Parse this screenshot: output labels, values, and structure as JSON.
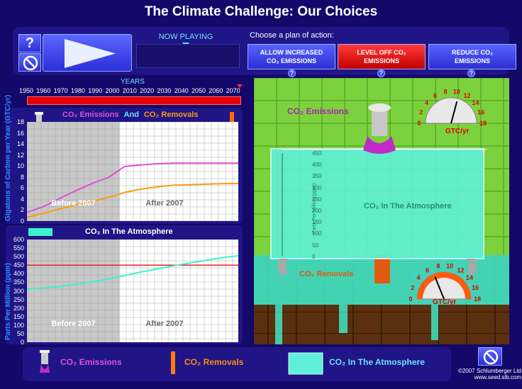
{
  "title": "The Climate Challenge: Our Choices",
  "controls": {
    "help_label": "?",
    "now_playing_label": "NOW PLAYING",
    "now_playing_value": ""
  },
  "plan": {
    "prompt": "Choose a plan of action:",
    "options": [
      {
        "line1": "ALLOW INCREASED",
        "line2": "CO₂ EMISSIONS",
        "selected": false
      },
      {
        "line1": "LEVEL OFF CO₂",
        "line2": "EMISSIONS",
        "selected": true
      },
      {
        "line1": "REDUCE CO₂",
        "line2": "EMISSIONS",
        "selected": false
      }
    ],
    "option_help": "?"
  },
  "timeline": {
    "label": "YEARS",
    "years": [
      "1950",
      "1960",
      "1970",
      "1980",
      "1990",
      "2000",
      "2010",
      "2020",
      "2030",
      "2040",
      "2050",
      "2060",
      "2070"
    ]
  },
  "chart_emissions": {
    "title_part1": "CO₂ Emissions",
    "title_and": "And",
    "title_part2": "CO₂ Removals",
    "ylabel": "Gigatons of Carbon per Year (GTC/yr)",
    "before_label": "Before 2007",
    "after_label": "After 2007",
    "colors": {
      "emissions": "#e050d8",
      "removals": "#ff9a10"
    }
  },
  "chart_atmosphere": {
    "title": "CO₂ In The Atmosphere",
    "ylabel": "Parts Per Million (ppm)",
    "before_label": "Before 2007",
    "after_label": "After 2007",
    "colors": {
      "co2": "#3ff0d0",
      "threshold": "#e82020"
    }
  },
  "chart_data": [
    {
      "type": "line",
      "title": "CO₂ Emissions And CO₂ Removals",
      "xlabel": "",
      "ylabel": "Gigatons of Carbon per Year (GTC/yr)",
      "xlim": [
        1950,
        2080
      ],
      "ylim": [
        0,
        18
      ],
      "yticks": [
        0,
        2,
        4,
        6,
        8,
        10,
        12,
        14,
        16,
        18
      ],
      "divider_x": 2007,
      "series": [
        {
          "name": "CO₂ Emissions",
          "x": [
            1950,
            1960,
            1970,
            1980,
            1990,
            2000,
            2007,
            2010,
            2020,
            2030,
            2040,
            2050,
            2060,
            2070,
            2080
          ],
          "values": [
            1.6,
            2.6,
            4.1,
            5.5,
            6.8,
            7.9,
            9.3,
            9.9,
            10.2,
            10.4,
            10.5,
            10.5,
            10.5,
            10.5,
            10.5
          ]
        },
        {
          "name": "CO₂ Removals",
          "x": [
            1950,
            1960,
            1970,
            1980,
            1990,
            2000,
            2007,
            2010,
            2020,
            2030,
            2040,
            2050,
            2060,
            2070,
            2080
          ],
          "values": [
            0.7,
            1.4,
            2.2,
            2.9,
            3.6,
            4.3,
            4.9,
            5.2,
            5.8,
            6.2,
            6.5,
            6.6,
            6.7,
            6.8,
            6.8
          ]
        }
      ]
    },
    {
      "type": "line",
      "title": "CO₂ In The Atmosphere",
      "xlabel": "",
      "ylabel": "Parts Per Million (ppm)",
      "xlim": [
        1950,
        2080
      ],
      "ylim": [
        0,
        600
      ],
      "yticks": [
        0,
        50,
        100,
        150,
        200,
        250,
        300,
        350,
        400,
        450,
        500,
        550,
        600
      ],
      "divider_x": 2007,
      "threshold": 450,
      "series": [
        {
          "name": "CO₂ In The Atmosphere",
          "x": [
            1950,
            1960,
            1970,
            1980,
            1990,
            2000,
            2007,
            2010,
            2020,
            2030,
            2040,
            2050,
            2060,
            2070,
            2080
          ],
          "values": [
            310,
            317,
            325,
            338,
            353,
            369,
            383,
            390,
            410,
            428,
            446,
            462,
            478,
            494,
            505
          ]
        }
      ]
    }
  ],
  "scene": {
    "emissions_label": "CO₂ Emissions",
    "removals_label": "CO₂ Removals",
    "atmosphere_label": "CO₂ In The Atmosphere",
    "tank_ylabel": "Parts Per Million (ppm)",
    "tank_ticks": [
      "450",
      "400",
      "350",
      "300",
      "250",
      "200",
      "150",
      "100",
      "50",
      "0"
    ],
    "gauge_unit": "GTC/yr",
    "gauge_ticks": [
      "0",
      "2",
      "4",
      "6",
      "8",
      "10",
      "12",
      "14",
      "16",
      "18"
    ],
    "emissions_gauge_value": 10.5,
    "removals_gauge_value": 6.8
  },
  "legend": {
    "emissions": "CO₂ Emissions",
    "removals": "CO₂ Removals",
    "atmosphere": "CO₂ In The Atmosphere"
  },
  "footer": {
    "copyright": "©2007 Schlumberger Ltd",
    "site": "www.seed.slb.com"
  }
}
